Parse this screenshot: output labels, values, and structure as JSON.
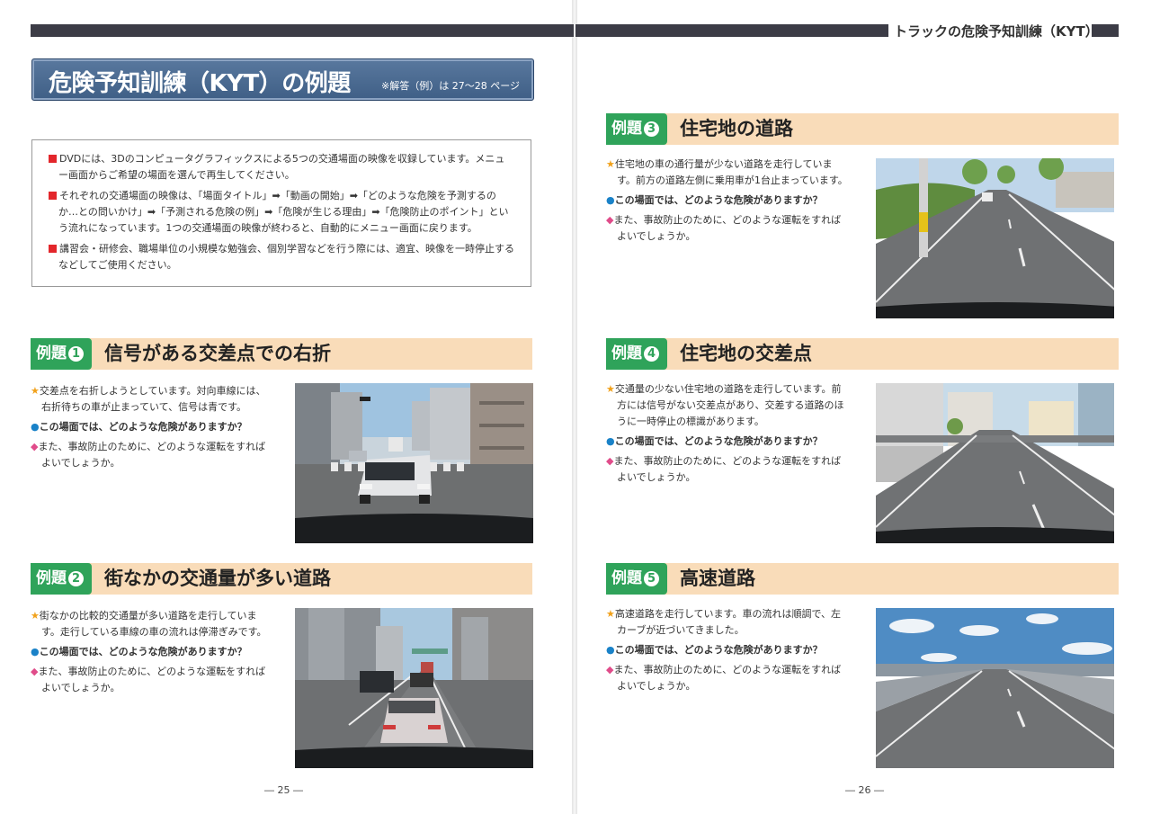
{
  "header": {
    "title": "トラックの危険予知訓練（KYT）"
  },
  "banner": {
    "title": "危険予知訓練（KYT）の例題",
    "note": "※解答（例）は 27〜28 ページ"
  },
  "intro": [
    "DVDには、3Dのコンピュータグラフィックスによる5つの交通場面の映像を収録しています。メニュー画面からご希望の場面を選んで再生してください。",
    "それぞれの交通場面の映像は、「場面タイトル」➡「動画の開始」➡「どのような危険を予測するのか…との問いかけ」➡「予測される危険の例」➡「危険が生じる理由」➡「危険防止のポイント」という流れになっています。1つの交通場面の映像が終わると、自動的にメニュー画面に戻ります。",
    "講習会・研修会、職場単位の小規模な勉強会、個別学習などを行う際には、適宜、映像を一時停止するなどしてご使用ください。"
  ],
  "examples": [
    {
      "label": "例題",
      "num": "1",
      "title": "信号がある交差点での右折",
      "desc": "交差点を右折しようとしています。対向車線には、右折待ちの車が止まっていて、信号は青です。",
      "question": "この場面では、どのような危険がありますか？",
      "followup": "また、事故防止のために、どのような運転をすればよいでしょうか。"
    },
    {
      "label": "例題",
      "num": "2",
      "title": "街なかの交通量が多い道路",
      "desc": "街なかの比較的交通量が多い道路を走行しています。走行している車線の車の流れは停滞ぎみです。",
      "question": "この場面では、どのような危険がありますか？",
      "followup": "また、事故防止のために、どのような運転をすればよいでしょうか。"
    },
    {
      "label": "例題",
      "num": "3",
      "title": "住宅地の道路",
      "desc": "住宅地の車の通行量が少ない道路を走行しています。前方の道路左側に乗用車が1台止まっています。",
      "question": "この場面では、どのような危険がありますか？",
      "followup": "また、事故防止のために、どのような運転をすればよいでしょうか。"
    },
    {
      "label": "例題",
      "num": "4",
      "title": "住宅地の交差点",
      "desc": "交通量の少ない住宅地の道路を走行しています。前方には信号がない交差点があり、交差する道路のほうに一時停止の標識があります。",
      "question": "この場面では、どのような危険がありますか？",
      "followup": "また、事故防止のために、どのような運転をすればよいでしょうか。"
    },
    {
      "label": "例題",
      "num": "5",
      "title": "高速道路",
      "desc": "高速道路を走行しています。車の流れは順調で、左カーブが近づいてきました。",
      "question": "この場面では、どのような危険がありますか？",
      "followup": "また、事故防止のために、どのような運転をすればよいでしょうか。"
    }
  ],
  "icons": {
    "star": "★",
    "dot": "●",
    "diamond": "◆"
  },
  "colors": {
    "banner": "#4a6a92",
    "badge": "#2fa35a",
    "example_header": "#f9dcb9",
    "bullet_square": "#e3262b",
    "star": "#f1a11b",
    "dot": "#1a82c8",
    "diamond": "#e04c8a"
  },
  "footer": {
    "left_page": "― 25 ―",
    "right_page": "― 26 ―"
  }
}
